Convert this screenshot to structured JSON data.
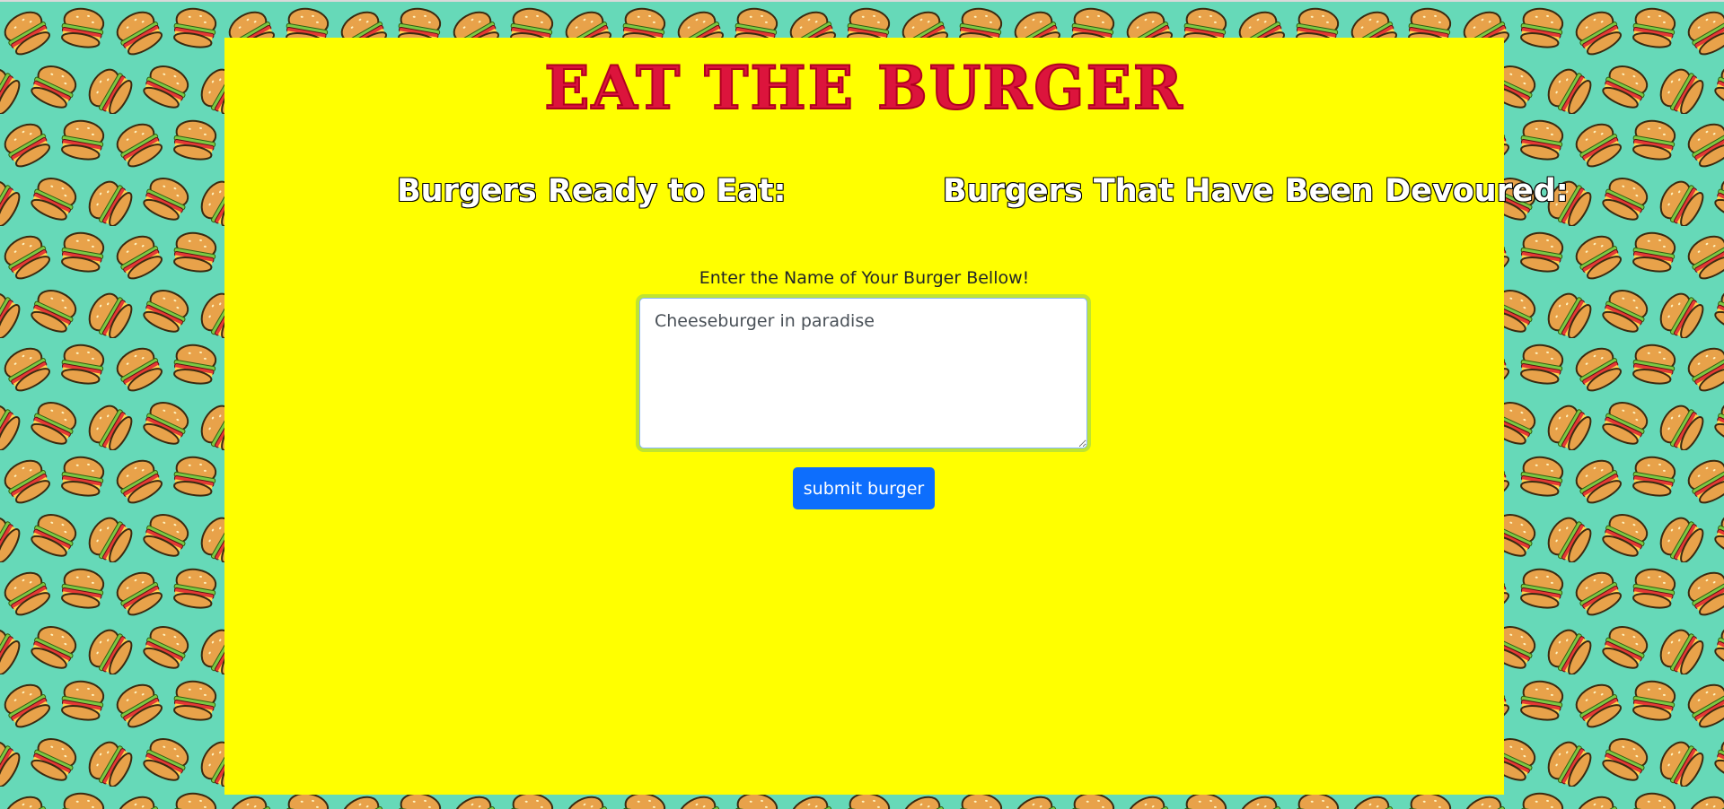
{
  "page": {
    "title": "Eat the Burger",
    "background_color": "#66d9b8",
    "panel_color": "#ffff00",
    "title_color": "#dc143c",
    "pattern_icon": "burger-icon"
  },
  "columns": {
    "ready_heading": "Burgers Ready to Eat:",
    "devoured_heading": "Burgers That Have Been Devoured:"
  },
  "form": {
    "label": "Enter the Name of Your Burger Bellow!",
    "input_value": "Cheeseburger in paradise",
    "submit_label": "submit burger",
    "submit_color": "#0d6efd"
  }
}
